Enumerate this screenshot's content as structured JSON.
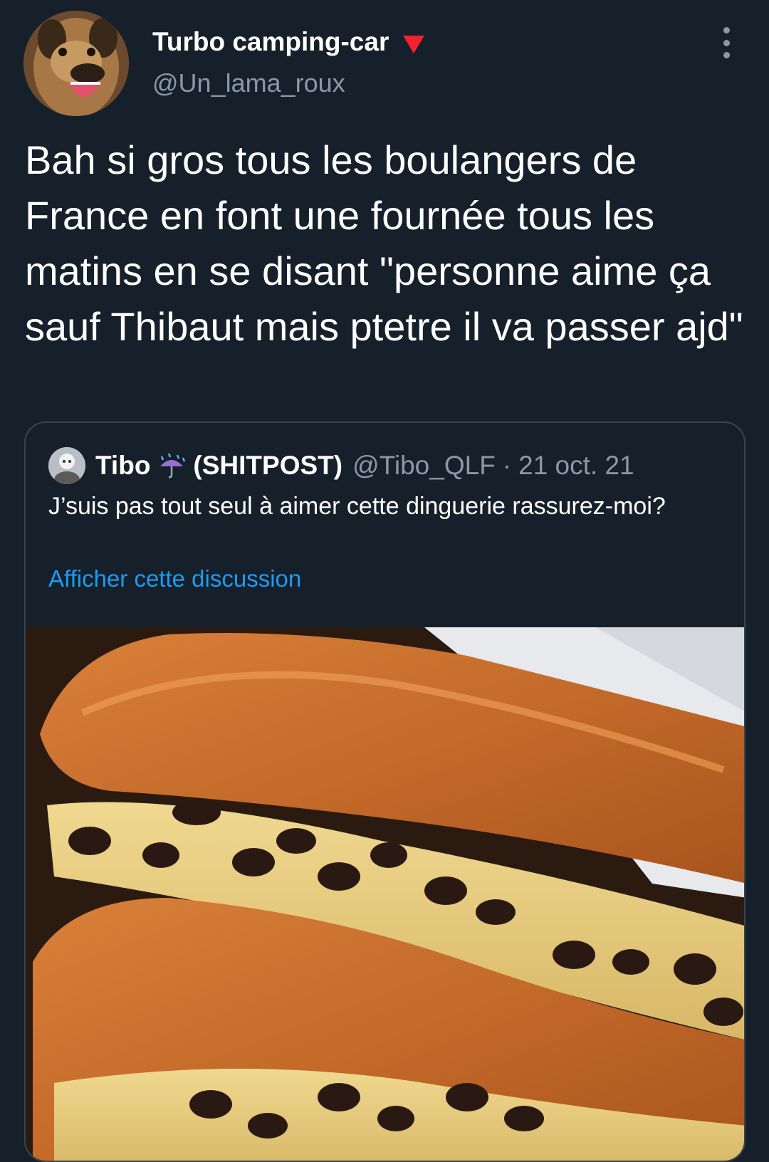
{
  "tweet": {
    "author_name": "Turbo camping-car",
    "author_handle": "@Un_lama_roux",
    "text": "Bah si gros tous les boulangers de France en font une fournée tous les matins en se disant \"personne aime ça sauf Thibaut mais ptetre il va passer ajd\""
  },
  "quoted": {
    "name": "Tibo",
    "tag": "(SHITPOST)",
    "handle": "@Tibo_QLF",
    "separator": "·",
    "date": "21 oct. 21",
    "text": "J’suis pas tout seul à aimer cette dinguerie rassurez-moi?",
    "show_thread": "Afficher cette discussion"
  },
  "colors": {
    "background": "#15202b",
    "text": "#ffffff",
    "secondary": "#8b98a5",
    "link": "#1d9bf0",
    "border": "#38444d",
    "badge": "#f4212e"
  },
  "icons": {
    "more": "more-dots-icon",
    "badge": "red-triangle-icon",
    "emoji": "umbrella-rain-emoji"
  }
}
